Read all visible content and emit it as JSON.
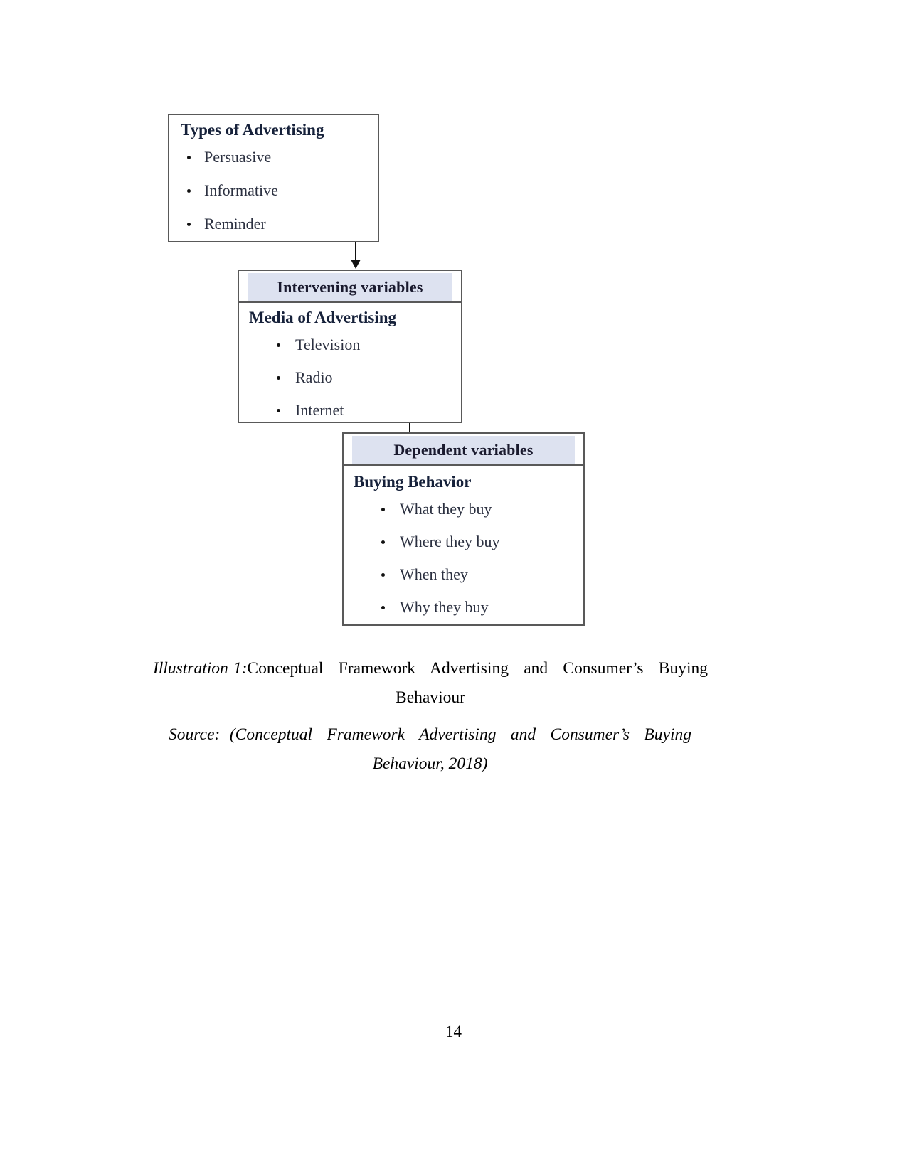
{
  "document": {
    "page_number": "14"
  },
  "diagram": {
    "boxes": [
      {
        "id": "types",
        "heading": "Types of Advertising",
        "items": [
          "Persuasive",
          "Informative",
          "Reminder"
        ]
      },
      {
        "id": "intervening",
        "band_label": "Intervening variables",
        "heading": "Media of Advertising",
        "items": [
          "Television",
          "Radio",
          "Internet"
        ]
      },
      {
        "id": "dependent",
        "band_label": "Dependent variables",
        "heading": "Buying Behavior",
        "items": [
          "What they buy",
          "Where they buy",
          "When they",
          "Why they buy"
        ]
      }
    ],
    "colors": {
      "band_fill": "#dde2f0",
      "box_border": "#595959",
      "arrow": "#111111"
    }
  },
  "caption": {
    "illustration_label": "Illustration 1:",
    "illustration_line1": "Conceptual   Framework   Advertising   and   Consumer’s   Buying",
    "illustration_line2": "Behaviour",
    "source_line1": "Source:  (Conceptual   Framework   Advertising   and   Consumer’s   Buying",
    "source_line2": "Behaviour, 2018)"
  }
}
